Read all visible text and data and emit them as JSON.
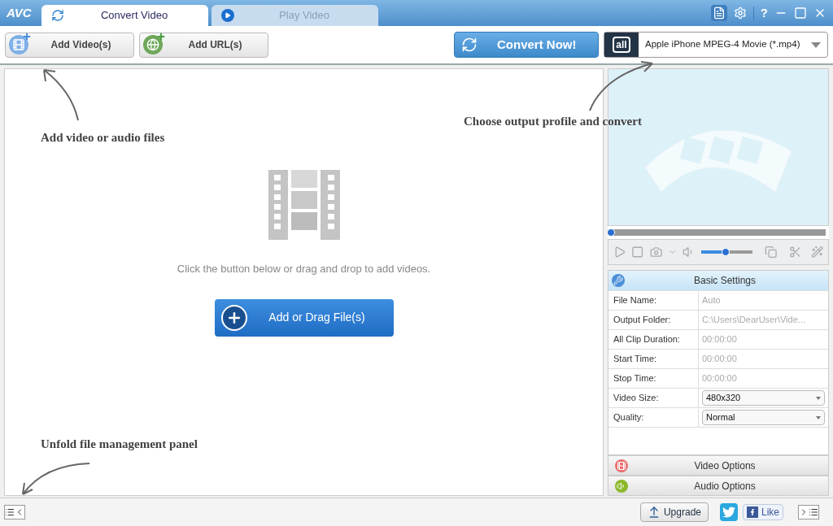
{
  "app": {
    "logo": "AVC",
    "help": "?"
  },
  "tabs": [
    {
      "label": "Convert Video",
      "selected": true,
      "kind": "convert"
    },
    {
      "label": "Play Video",
      "selected": false,
      "kind": "play"
    }
  ],
  "toolbar": {
    "buttons": [
      {
        "label": "Add Video(s)",
        "kind": "video"
      },
      {
        "label": "Add URL(s)",
        "kind": "url"
      }
    ],
    "convert": "Convert Now!",
    "profile_badge": "all",
    "profile": "Apple iPhone MPEG-4 Movie (*.mp4)"
  },
  "annotations": [
    {
      "text": "Add video or audio files",
      "kind": "add"
    },
    {
      "text": "Choose output profile and convert",
      "kind": "profile"
    },
    {
      "text": "Unfold file management panel",
      "kind": "unfold"
    }
  ],
  "drop_area": {
    "hint": "Click the button below or drag and drop to add videos.",
    "button": "Add or Drag File(s)"
  },
  "player": {
    "seek": {
      "level": 0
    },
    "volume": {
      "level": 0.48
    }
  },
  "basic_settings": {
    "title": "Basic Settings",
    "rows": [
      {
        "label": "File Name:",
        "value": "Auto",
        "kind": "text"
      },
      {
        "label": "Output Folder:",
        "value": "C:\\Users\\DearUser\\Vide...",
        "kind": "text"
      },
      {
        "label": "All Clip Duration:",
        "value": "00:00:00",
        "kind": "text"
      },
      {
        "label": "Start Time:",
        "value": "00:00:00",
        "kind": "text"
      },
      {
        "label": "Stop Time:",
        "value": "00:00:00",
        "kind": "text"
      },
      {
        "label": "Video Size:",
        "value": "480x320",
        "kind": "select"
      },
      {
        "label": "Quality:",
        "value": "Normal",
        "kind": "select"
      }
    ]
  },
  "sections": [
    {
      "label": "Video Options",
      "kind": "video"
    },
    {
      "label": "Audio Options",
      "kind": "audio"
    }
  ],
  "status_bar": {
    "upgrade": "Upgrade",
    "like": "Like"
  }
}
